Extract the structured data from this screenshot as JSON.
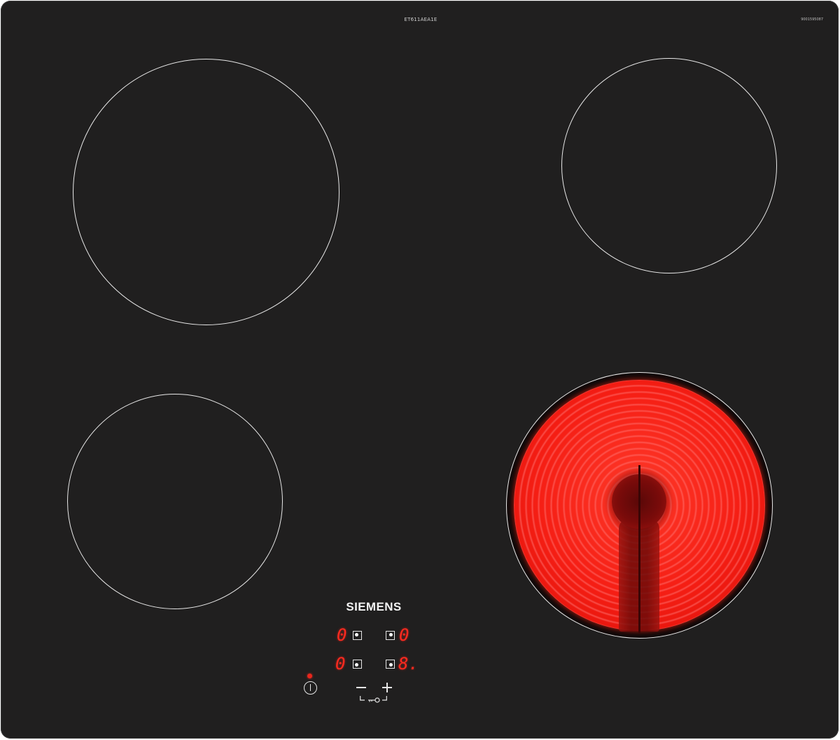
{
  "hob": {
    "model": "ET611AEA1E",
    "serial": "9001595087",
    "brand": "SIEMENS"
  },
  "zones": [
    {
      "id": "front-left",
      "state": "off"
    },
    {
      "id": "back-right",
      "state": "off"
    },
    {
      "id": "rear-left",
      "state": "off"
    },
    {
      "id": "front-right",
      "state": "heating",
      "glow_color": "#f51e14"
    }
  ],
  "display": {
    "top_left_level": "0",
    "top_right_level": "0",
    "bottom_left_level": "0",
    "bottom_right_level": "8."
  },
  "colors": {
    "glass": "#201f1f",
    "ring": "#e9e9e9",
    "led": "#ff2a1f"
  },
  "icons": {
    "power": "power-icon",
    "minus": "minus-icon",
    "plus": "plus-icon",
    "lock": "key-lock-icon"
  }
}
